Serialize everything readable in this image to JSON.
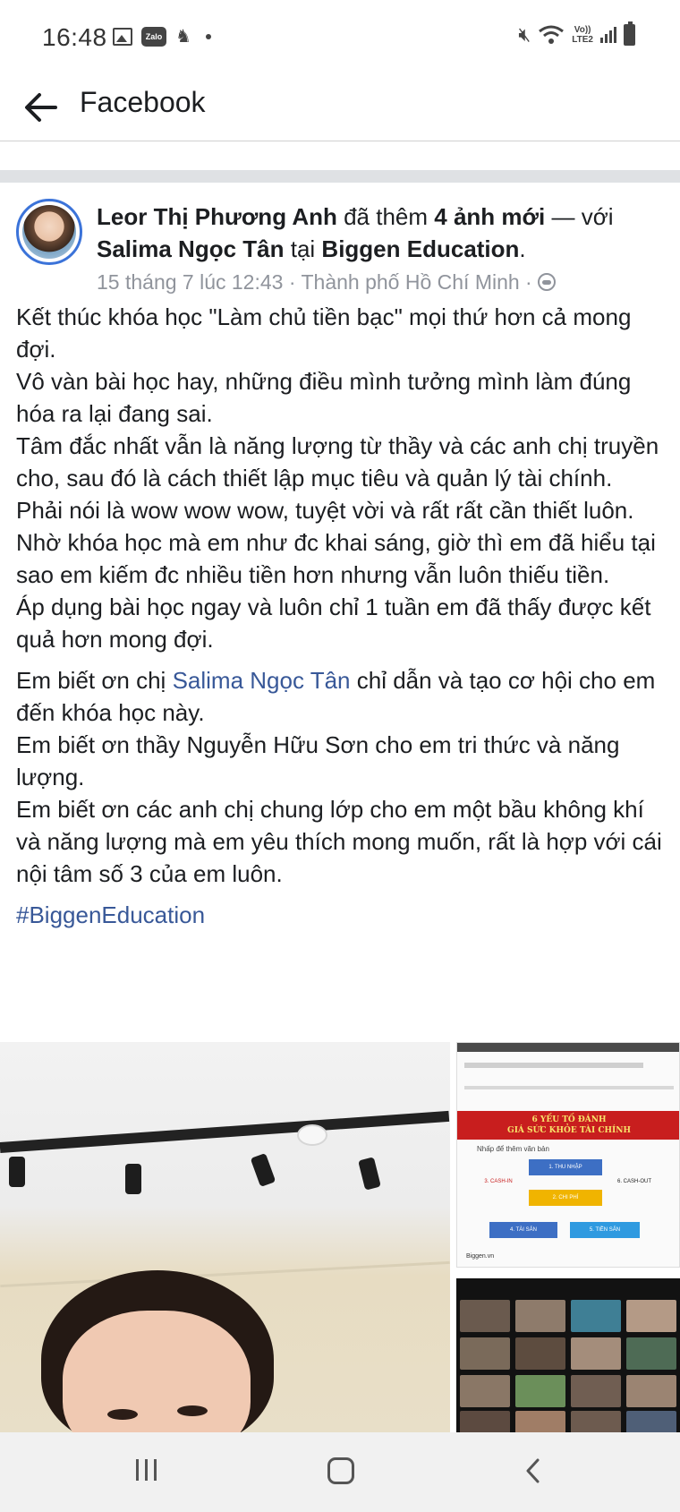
{
  "status_bar": {
    "time": "16:48",
    "left_icons": [
      "image-icon",
      "zalo-icon",
      "person-icon",
      "dot-icon"
    ],
    "zalo_label": "Zalo",
    "right_icons": [
      "mute-icon",
      "wifi-icon",
      "lte-icon",
      "signal-icon",
      "battery-icon"
    ],
    "lte_line1": "Vo))",
    "lte_line2": "LTE2"
  },
  "header": {
    "title": "Facebook",
    "back_icon": "back-arrow-icon"
  },
  "post": {
    "author": "Leor Thị Phương Anh",
    "action_prefix": " đã thêm ",
    "action_count": "4 ảnh mới",
    "action_with": " — với ",
    "tagged": "Salima Ngọc Tân",
    "location_prefix": " tại ",
    "location": "Biggen Education",
    "location_suffix": ".",
    "meta": "15 tháng 7 lúc 12:43 · Thành phố Hồ Chí Minh ·",
    "privacy_icon": "globe-icon",
    "paragraphs": [
      "Kết thúc khóa học \"Làm chủ tiền bạc\" mọi thứ hơn cả mong đợi.",
      "Vô vàn bài học hay, những điều mình tưởng mình làm đúng hóa ra lại đang sai.",
      "Tâm đắc nhất vẫn là năng lượng từ thầy và các anh chị truyền cho, sau đó là cách thiết lập mục tiêu và quản lý tài chính.",
      "Phải nói là wow wow wow, tuyệt vời và rất rất cần thiết luôn.",
      "Nhờ khóa học mà em như đc khai sáng, giờ thì em đã hiểu tại sao em kiếm đc nhiều tiền hơn nhưng vẫn luôn thiếu tiền.",
      "Áp dụng bài học ngay và luôn chỉ 1 tuần em đã thấy được kết quả hơn mong đợi."
    ],
    "gratitude_1_prefix": "Em biết ơn chị ",
    "gratitude_1_mention": "Salima Ngọc Tân",
    "gratitude_1_suffix": " chỉ dẫn và tạo cơ hội cho em đến khóa học này.",
    "gratitude_2": "Em biết ơn thầy Nguyễn Hữu Sơn cho em tri thức và năng lượng.",
    "gratitude_3": "Em biết ơn các anh chị chung lớp cho em một bầu không khí và năng lượng mà em yêu thích mong muốn, rất là hợp với cái nội tâm số 3 của em luôn.",
    "hashtag": "#BiggenEducation"
  },
  "photos": {
    "slide_title_line1": "6 YẾU TỐ ĐÁNH",
    "slide_title_line2": "GIÁ SỨC KHỎE TÀI CHÍNH",
    "slide_note": "Nhấp để thêm văn bản",
    "slide_boxes": [
      "1. THU NHẬP",
      "2. CHI PHÍ",
      "3. CASH-IN",
      "4. TÀI SẢN",
      "5. TIỀN SẢN",
      "6. CASH-OUT"
    ],
    "slide_footer": "Biggen.vn"
  },
  "nav_bar": {
    "icons": [
      "recent-apps-icon",
      "home-icon",
      "back-icon"
    ]
  },
  "colors": {
    "link": "#385898",
    "meta_gray": "#90949c",
    "avatar_ring": "#3b73d9",
    "slide_banner": "#c81e1e"
  }
}
